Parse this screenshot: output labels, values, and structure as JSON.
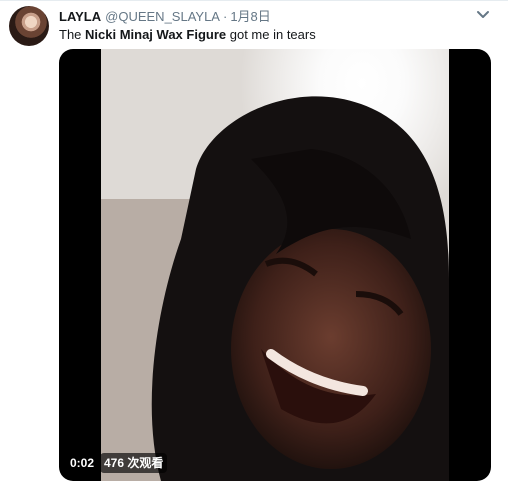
{
  "tweet": {
    "display_name": "LAYLA",
    "handle": "@QUEEN_SLAYLA",
    "separator": "·",
    "timestamp": "1月8日",
    "text_prefix": "The ",
    "text_bold": "Nicki Minaj Wax Figure",
    "text_suffix": " got me in tears"
  },
  "video": {
    "duration": "0:02",
    "views": "476 次观看"
  },
  "icons": {
    "menu": "chevron-down-icon"
  },
  "colors": {
    "text_primary": "#14171a",
    "text_secondary": "#657786",
    "media_background": "#000000"
  }
}
